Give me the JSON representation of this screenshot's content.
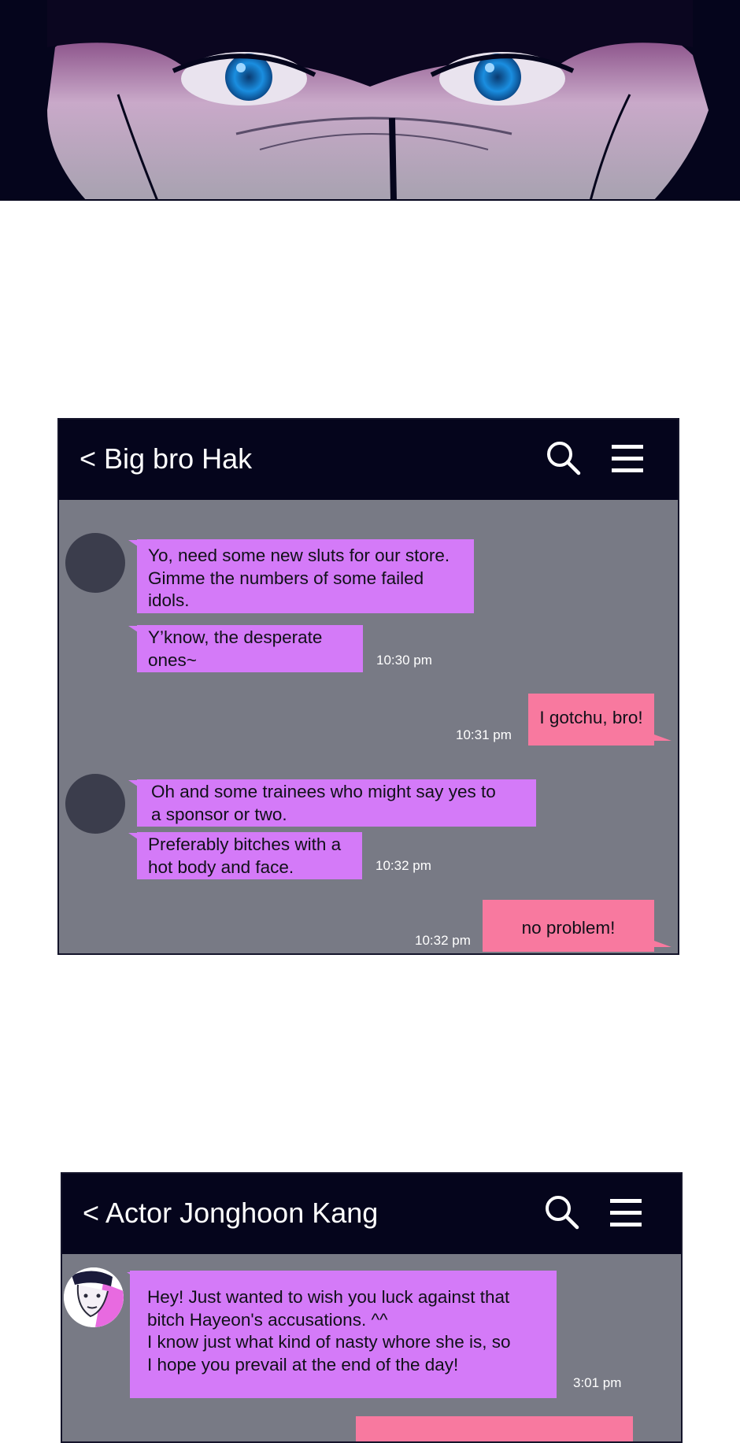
{
  "chat1": {
    "title": "< Big bro Hak",
    "icons": [
      "search-icon",
      "menu-icon"
    ],
    "messages": [
      {
        "from": "contact",
        "text": "Yo, need some new sluts for our store.\nGimme the numbers of some failed\nidols."
      },
      {
        "from": "contact",
        "text": "Y’know, the desperate\nones~",
        "time": "10:30 pm"
      },
      {
        "from": "me",
        "text": "I gotchu, bro!",
        "time": "10:31 pm"
      },
      {
        "from": "contact",
        "text": "Oh and some trainees who might say yes to\na sponsor or two."
      },
      {
        "from": "contact",
        "text": "Preferably bitches with a\nhot body and face.",
        "time": "10:32 pm"
      },
      {
        "from": "me",
        "text": "no problem!",
        "time": "10:32 pm"
      }
    ]
  },
  "chat2": {
    "title": "< Actor Jonghoon Kang",
    "icons": [
      "search-icon",
      "menu-icon"
    ],
    "messages": [
      {
        "from": "contact",
        "text": "Hey! Just wanted to wish you luck against that\nbitch Hayeon's accusations. ^^\nI know just what kind of nasty whore she is, so\nI hope you prevail at the end of the day!",
        "time": "3:01 pm"
      }
    ]
  },
  "colors": {
    "header": "#05051c",
    "chat_bg": "#787a85",
    "contact_bubble": "#d47af8",
    "my_bubble": "#f8799f",
    "avatar": "#3b3d4c"
  }
}
